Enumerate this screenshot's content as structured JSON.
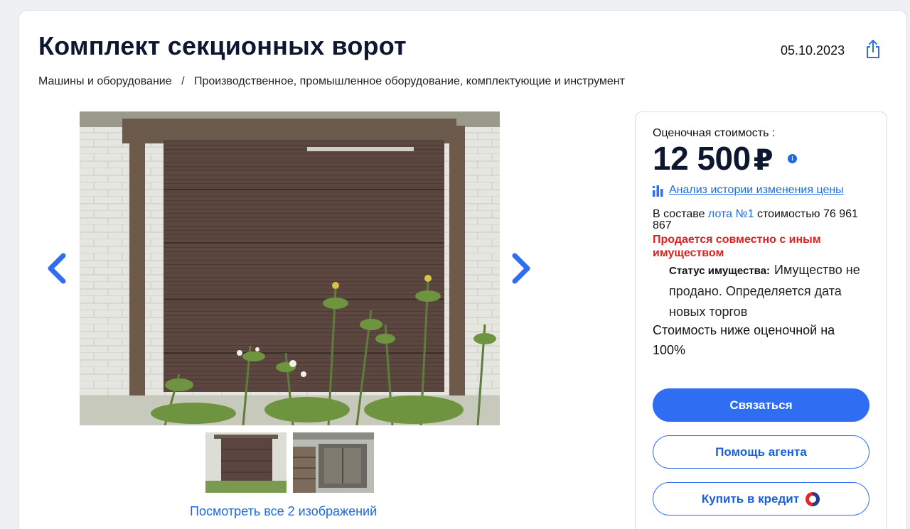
{
  "header": {
    "title": "Комплект секционных ворот",
    "date": "05.10.2023"
  },
  "breadcrumb": {
    "items": [
      "Машины и оборудование",
      "Производственное, промышленное оборудование, комплектующие и инструмент"
    ],
    "separator": "/"
  },
  "gallery": {
    "see_all_label": "Посмотреть все 2 изображений"
  },
  "price_panel": {
    "estimate_label": "Оценочная стоимость :",
    "price_value": "12 500",
    "currency": "₽",
    "info_icon_text": "i",
    "history_link": "Анализ истории изменения цены",
    "composition_prefix": "В составе",
    "composition_lot": "лота №1",
    "composition_suffix": "стоимостью 76 961 867",
    "joint_sale": "Продается совместно с иным имуществом",
    "status_label": "Статус имущества:",
    "status_value": "Имущество не продано. Определяется дата новых торгов",
    "below_estimate": "Стоимость ниже оценочной на 100%"
  },
  "actions": {
    "contact": "Связаться",
    "agent_help": "Помощь агента",
    "buy_credit": "Купить в кредит"
  },
  "colors": {
    "accent": "#2f6ef3",
    "link": "#1d6ae5",
    "warning": "#e0201e",
    "title": "#0d1730"
  },
  "icons": {
    "share": "share-icon",
    "prev": "chevron-left-icon",
    "next": "chevron-right-icon",
    "history": "bar-chart-icon",
    "info": "info-icon",
    "credit": "bank-logo-icon"
  }
}
